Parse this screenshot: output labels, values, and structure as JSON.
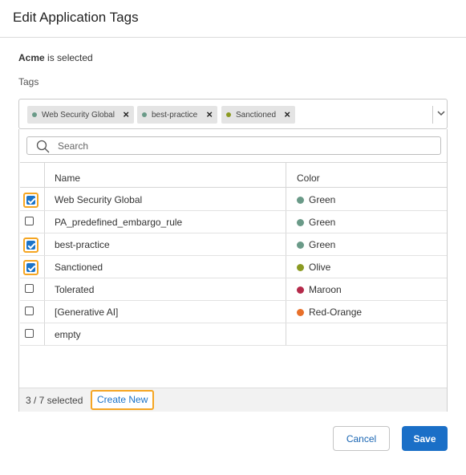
{
  "dialog": {
    "title": "Edit Application Tags",
    "selected_name": "Acme",
    "selected_suffix": " is selected",
    "tags_label": "Tags"
  },
  "chips": [
    {
      "label": "Web Security Global",
      "dot_color": "#6a9a88"
    },
    {
      "label": "best-practice",
      "dot_color": "#6a9a88"
    },
    {
      "label": "Sanctioned",
      "dot_color": "#8b9a22"
    }
  ],
  "search": {
    "placeholder": "Search",
    "value": ""
  },
  "table": {
    "headers": {
      "name": "Name",
      "color": "Color"
    },
    "rows": [
      {
        "name": "Web Security Global",
        "color": "Green",
        "color_hex": "#6a9a88",
        "checked": true
      },
      {
        "name": "PA_predefined_embargo_rule",
        "color": "Green",
        "color_hex": "#6a9a88",
        "checked": false
      },
      {
        "name": "best-practice",
        "color": "Green",
        "color_hex": "#6a9a88",
        "checked": true
      },
      {
        "name": "Sanctioned",
        "color": "Olive",
        "color_hex": "#8b9a22",
        "checked": true
      },
      {
        "name": "Tolerated",
        "color": "Maroon",
        "color_hex": "#b52a4a",
        "checked": false
      },
      {
        "name": "[Generative AI]",
        "color": "Red-Orange",
        "color_hex": "#e8702a",
        "checked": false
      },
      {
        "name": "empty",
        "color": "",
        "color_hex": "",
        "checked": false
      }
    ]
  },
  "footer": {
    "count_text": "3 / 7 selected",
    "create_new": "Create New"
  },
  "buttons": {
    "cancel": "Cancel",
    "save": "Save"
  },
  "colors": {
    "accent": "#1a6fc7",
    "highlight": "#f5a623"
  }
}
